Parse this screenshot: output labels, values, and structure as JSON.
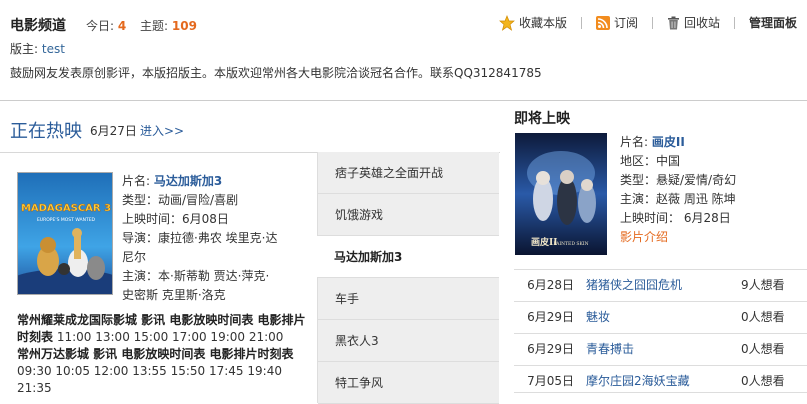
{
  "header": {
    "title": "电影频道",
    "today_label": "今日:",
    "today_count": "4",
    "topics_label": "主题:",
    "topics_count": "109",
    "actions": {
      "favorite": "收藏本版",
      "subscribe": "订阅",
      "recycle": "回收站",
      "manage": "管理面板"
    },
    "moderator_label": "版主:",
    "moderator_name": "test",
    "notice": "鼓励网友发表原创影评，本版招版主。本版欢迎常州各大电影院洽谈冠名合作。联系QQ312841785"
  },
  "now_showing": {
    "title": "正在热映",
    "date": "6月27日",
    "more": "进入>>",
    "movie": {
      "name_label": "片名:",
      "name": "马达加斯加3",
      "genre": "类型：动画/冒险/喜剧",
      "release": "上映时间：6月08日",
      "director_1": "导演：康拉德·弗农  埃里克·达",
      "director_2": "尼尔",
      "cast_1": "主演：本·斯蒂勒  贾达·萍克·",
      "cast_2": "史密斯  克里斯·洛克"
    },
    "cinemas": [
      {
        "name": "常州耀莱成龙国际影城  影讯  电影放映时间表  电影排片时刻表",
        "times": "11:00 13:00 15:00 17:00 19:00 21:00"
      },
      {
        "name": "常州万达影城  影讯  电影放映时间表  电影排片时刻表",
        "times": "09:30 10:05 12:00 13:55 15:50 17:45 19:40 21:35"
      }
    ],
    "tabs": [
      "痞子英雄之全面开战",
      "饥饿游戏",
      "马达加斯加3",
      "车手",
      "黑衣人3",
      "特工争风"
    ]
  },
  "upcoming": {
    "title": "即将上映",
    "movie": {
      "name_label": "片名:",
      "name": "画皮II",
      "region": "地区：中国",
      "genre": "类型：悬疑/爱情/奇幻",
      "cast": "主演：赵薇  周迅  陈坤",
      "release": "上映时间：  6月28日",
      "intro": "影片介绍"
    },
    "list": [
      {
        "date": "6月28日",
        "title": "猪猪侠之囧囧危机",
        "count": "9人想看"
      },
      {
        "date": "6月29日",
        "title": "魅妆",
        "count": "0人想看"
      },
      {
        "date": "6月29日",
        "title": "青春搏击",
        "count": "0人想看"
      },
      {
        "date": "7月05日",
        "title": "摩尔庄园2海妖宝藏",
        "count": "0人想看"
      }
    ]
  },
  "poster_text": {
    "main": "MADAGASCAR 3",
    "sub": "EUROPE'S MOST WANTED",
    "painted": "PAINTED SKIN",
    "chinese": "画皮II"
  }
}
